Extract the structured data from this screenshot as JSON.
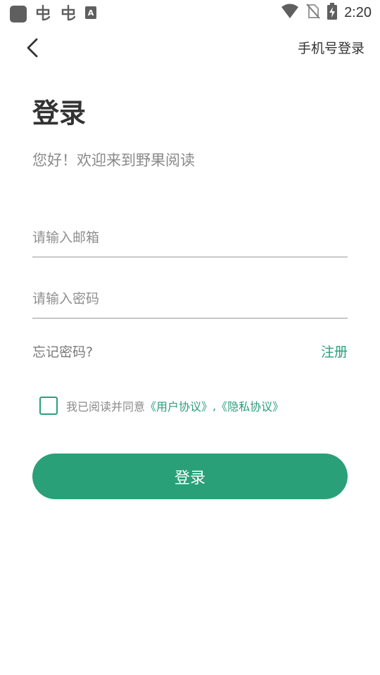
{
  "status_bar": {
    "time": "2:20",
    "icons": [
      "app-square-icon",
      "bug-icon",
      "bug-icon",
      "text-a-icon",
      "wifi-icon",
      "no-sim-icon",
      "battery-charging-icon"
    ]
  },
  "header": {
    "back_icon": "chevron-left-icon",
    "phone_login": "手机号登录"
  },
  "main": {
    "title": "登录",
    "welcome": "您好！欢迎来到野果阅读",
    "email_placeholder": "请输入邮箱",
    "password_placeholder": "请输入密码",
    "forgot_password": "忘记密码?",
    "register": "注册",
    "agreement": {
      "prefix": "我已阅读并同意",
      "user_agreement": "《用户协议》",
      "separator": ",",
      "privacy_policy": "《隐私协议》"
    },
    "login_button": "登录"
  },
  "colors": {
    "accent": "#2aa079",
    "text_primary": "#333333",
    "text_secondary": "#8a8a8a"
  }
}
